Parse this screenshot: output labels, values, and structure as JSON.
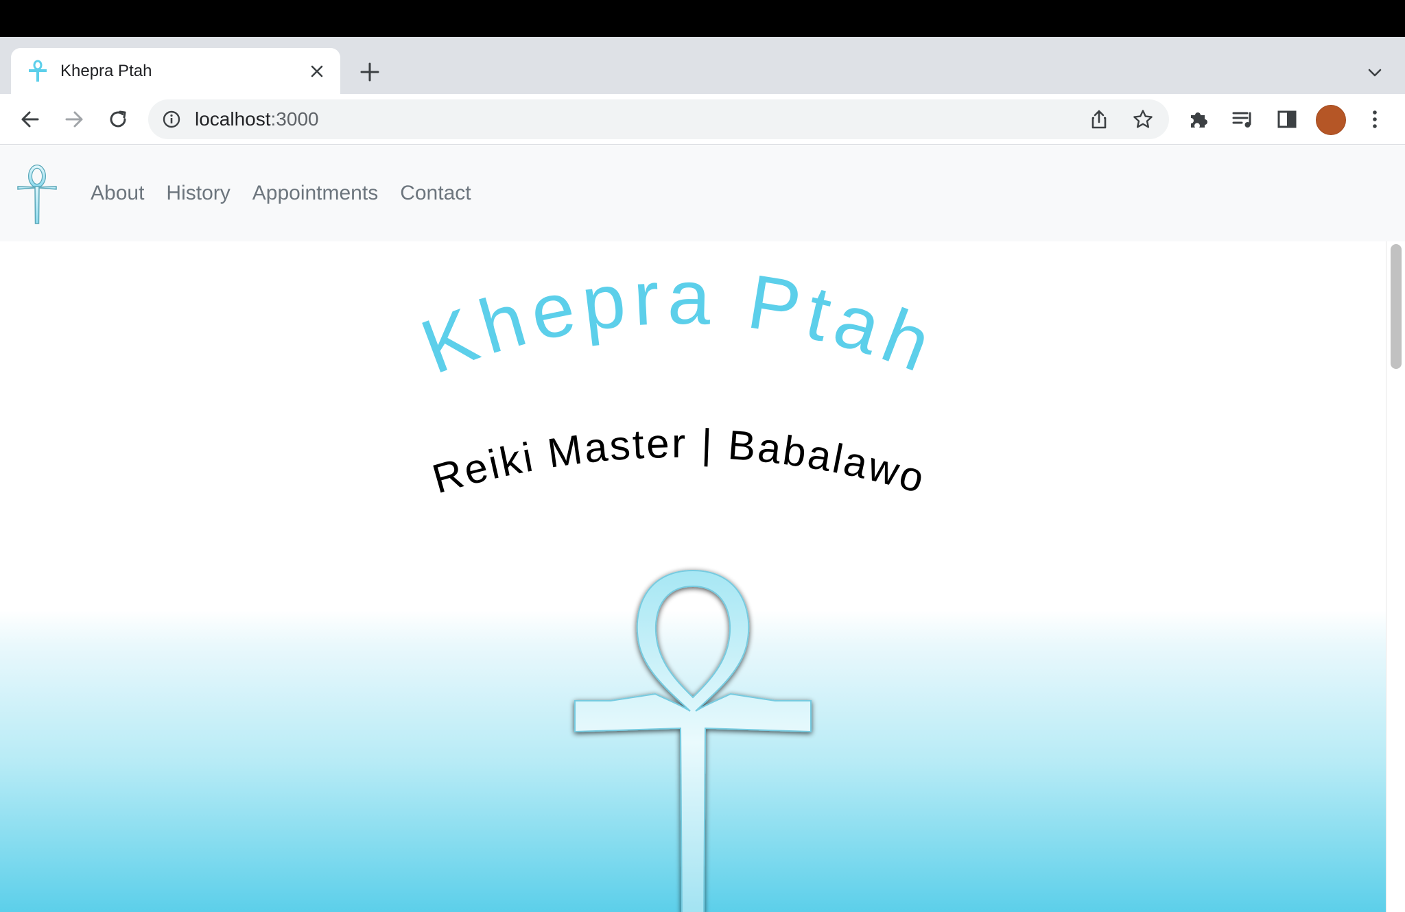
{
  "browser": {
    "tab_title": "Khepra Ptah",
    "url_host": "localhost",
    "url_port": ":3000"
  },
  "site": {
    "nav_links": [
      "About",
      "History",
      "Appointments",
      "Contact"
    ],
    "title": "Khepra Ptah",
    "subtitle": "Reiki Master | Babalawo"
  },
  "icons": {
    "tab_favicon": "ankh-icon",
    "tab_close": "close-icon",
    "new_tab": "plus-icon",
    "tab_search": "chevron-down-icon",
    "back": "arrow-left-icon",
    "forward": "arrow-right-icon",
    "reload": "reload-icon",
    "site_info": "info-icon",
    "share": "share-icon",
    "bookmark": "star-icon",
    "extensions": "puzzle-icon",
    "media": "media-queue-icon",
    "side_panel": "side-panel-icon",
    "menu": "kebab-menu-icon",
    "brand": "ankh-icon"
  },
  "colors": {
    "accent": "#5ccfea",
    "title_color": "#5ccfea",
    "subtitle_color": "#000000",
    "nav_link_color": "#6c757d",
    "avatar_color": "#b55626"
  }
}
